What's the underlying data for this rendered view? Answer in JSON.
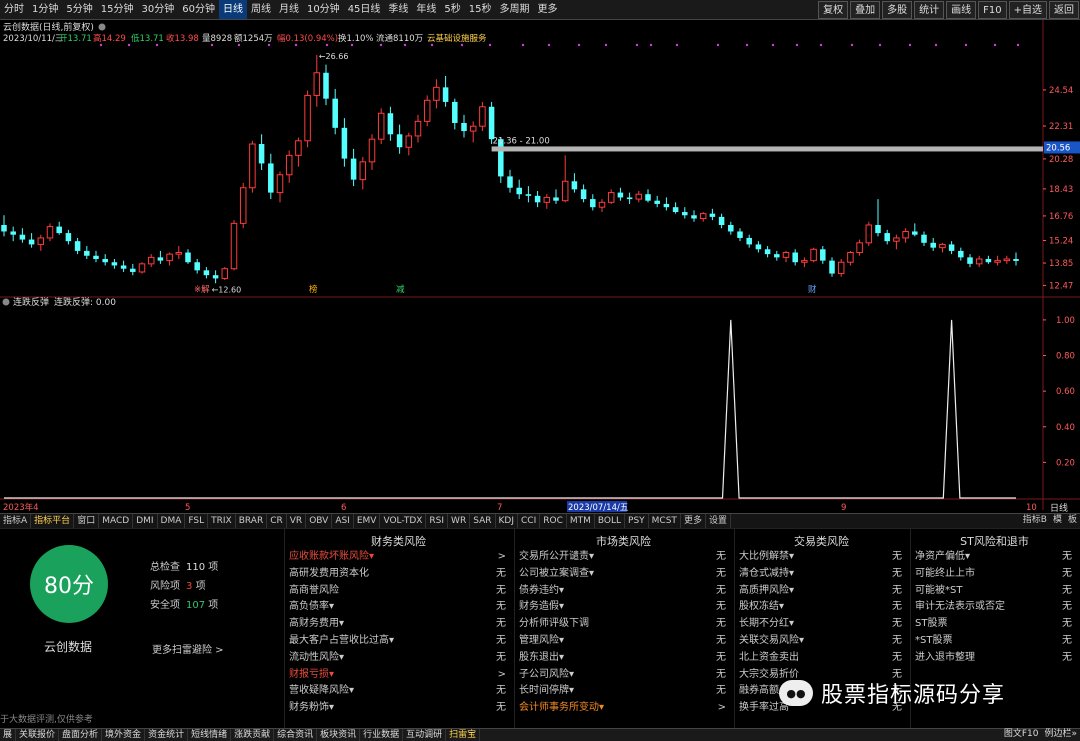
{
  "toolbar": {
    "periods": [
      "分时",
      "1分钟",
      "5分钟",
      "15分钟",
      "30分钟",
      "60分钟",
      "日线",
      "周线",
      "月线",
      "10分钟",
      "45日线",
      "季线",
      "年线",
      "5秒",
      "15秒",
      "多周期",
      "更多"
    ],
    "active_period": "日线",
    "right_buttons": [
      "复权",
      "叠加",
      "多股",
      "统计",
      "画线",
      "F10",
      "+自选",
      "返回"
    ]
  },
  "chart_header": {
    "title": "云创数据(日线,前复权)",
    "info_date": "2023/10/11/三",
    "info_open": "开13.71",
    "info_high": "高14.29",
    "info_low": "低13.71",
    "info_close": "收13.98",
    "info_volume": "量8928",
    "info_amount": "额1254万",
    "info_change": "幅0.13(0.94%)",
    "info_turnover": "换1.10%",
    "info_float": "流通8110万",
    "info_concept": "云基础设施服务"
  },
  "price_axis": {
    "labels": [
      "24.54",
      "22.31",
      "20.28",
      "18.43",
      "16.76",
      "15.24",
      "13.85",
      "12.47"
    ],
    "current_price": "20.56"
  },
  "annotations": {
    "high_mark": "26.66",
    "low_mark": "12.60",
    "range_label": "21.36 - 21.00",
    "event_markers": [
      "※解",
      "榜",
      "减",
      "财"
    ]
  },
  "lower_panel": {
    "title": "连跌反弹",
    "label": "连跌反弹: 0.00",
    "axis_labels": [
      "1.00",
      "0.80",
      "0.60",
      "0.40",
      "0.20"
    ]
  },
  "time_axis": {
    "labels": [
      "2023年4",
      "5",
      "6",
      "7",
      "2023/07/14/五",
      "9",
      "10"
    ],
    "right_label": "日线"
  },
  "indicator_tabs": {
    "items": [
      "指标A",
      "指标平台",
      "窗口",
      "MACD",
      "DMI",
      "DMA",
      "FSL",
      "TRIX",
      "BRAR",
      "CR",
      "VR",
      "OBV",
      "ASI",
      "EMV",
      "VOL-TDX",
      "RSI",
      "WR",
      "SAR",
      "KDJ",
      "CCI",
      "ROC",
      "MTM",
      "BOLL",
      "PSY",
      "MCST",
      "更多",
      "设置"
    ],
    "active": "指标平台",
    "right_items": [
      "指标B",
      "模",
      "板"
    ]
  },
  "risk": {
    "score": "80分",
    "brand": "云创数据",
    "total_label": "总检查",
    "total_value": "110",
    "total_unit": "项",
    "risk_label": "风险项",
    "risk_value": "3",
    "risk_unit": "项",
    "safe_label": "安全项",
    "safe_value": "107",
    "safe_unit": "项",
    "more_scan": "更多扫雷避险 >",
    "disclaimer": "于大数据评测,仅供参考",
    "columns": [
      {
        "title": "财务类风险",
        "rows": [
          {
            "label": "应收账款坏账风险▾",
            "value": ">",
            "style": "warn"
          },
          {
            "label": "高研发费用资本化",
            "value": "无",
            "style": ""
          },
          {
            "label": "高商誉风险",
            "value": "无",
            "style": ""
          },
          {
            "label": "高负债率▾",
            "value": "无",
            "style": ""
          },
          {
            "label": "高财务费用▾",
            "value": "无",
            "style": ""
          },
          {
            "label": "最大客户占营收比过高▾",
            "value": "无",
            "style": ""
          },
          {
            "label": "流动性风险▾",
            "value": "无",
            "style": ""
          },
          {
            "label": "财报亏损▾",
            "value": ">",
            "style": "warn"
          },
          {
            "label": "营收疑降风险▾",
            "value": "无",
            "style": ""
          },
          {
            "label": "财务粉饰▾",
            "value": "无",
            "style": ""
          }
        ]
      },
      {
        "title": "市场类风险",
        "rows": [
          {
            "label": "交易所公开谴责▾",
            "value": "无",
            "style": ""
          },
          {
            "label": "公司被立案调查▾",
            "value": "无",
            "style": ""
          },
          {
            "label": "债券违约▾",
            "value": "无",
            "style": ""
          },
          {
            "label": "财务造假▾",
            "value": "无",
            "style": ""
          },
          {
            "label": "分析师评级下调",
            "value": "无",
            "style": ""
          },
          {
            "label": "管理风险▾",
            "value": "无",
            "style": ""
          },
          {
            "label": "股东退出▾",
            "value": "无",
            "style": ""
          },
          {
            "label": "子公司风险▾",
            "value": "无",
            "style": ""
          },
          {
            "label": "长时间停牌▾",
            "value": "无",
            "style": ""
          },
          {
            "label": "会计师事务所变动▾",
            "value": ">",
            "style": "orange"
          }
        ]
      },
      {
        "title": "交易类风险",
        "rows": [
          {
            "label": "大比例解禁▾",
            "value": "无",
            "style": ""
          },
          {
            "label": "清仓式减持▾",
            "value": "无",
            "style": ""
          },
          {
            "label": "高质押风险▾",
            "value": "无",
            "style": ""
          },
          {
            "label": "股权冻结▾",
            "value": "无",
            "style": ""
          },
          {
            "label": "长期不分红▾",
            "value": "无",
            "style": ""
          },
          {
            "label": "关联交易风险▾",
            "value": "无",
            "style": ""
          },
          {
            "label": "北上资金卖出",
            "value": "无",
            "style": ""
          },
          {
            "label": "大宗交易折价",
            "value": "无",
            "style": ""
          },
          {
            "label": "融券高额",
            "value": "无",
            "style": ""
          },
          {
            "label": "换手率过高",
            "value": "无",
            "style": ""
          }
        ]
      },
      {
        "title": "ST风险和退市",
        "rows": [
          {
            "label": "净资产偏低▾",
            "value": "无",
            "style": ""
          },
          {
            "label": "可能终止上市",
            "value": "无",
            "style": ""
          },
          {
            "label": "可能被*ST",
            "value": "无",
            "style": ""
          },
          {
            "label": "审计无法表示或否定",
            "value": "无",
            "style": ""
          },
          {
            "label": "ST股票",
            "value": "无",
            "style": ""
          },
          {
            "label": "*ST股票",
            "value": "无",
            "style": ""
          },
          {
            "label": "进入退市整理",
            "value": "无",
            "style": ""
          }
        ]
      }
    ]
  },
  "bottom_bar": {
    "items": [
      "展",
      "关联报价",
      "盘面分析",
      "境外资金",
      "资金统计",
      "短线情绪",
      "涨跌贡献",
      "综合资讯",
      "板块资讯",
      "行业数据",
      "互动调研",
      "扫雷宝"
    ],
    "active": "扫雷宝",
    "right_items": [
      "图文F10",
      "例边栏»"
    ]
  },
  "watermark": {
    "text": "股票指标源码分享"
  },
  "colors": {
    "up": "#ff3b3b",
    "down": "#54ffff",
    "score_green": "#1aa15c",
    "background": "#000000"
  },
  "chart_data": [
    {
      "type": "candlestick",
      "title": "云创数据(日线,前复权)",
      "ylim": [
        12.0,
        27.5
      ],
      "y_ticks": [
        24.54,
        22.31,
        20.28,
        18.43,
        16.76,
        15.24,
        13.85,
        12.47
      ],
      "x_month_labels": [
        "2023年4",
        "5",
        "6",
        "7",
        "9",
        "10"
      ],
      "ohlc": [
        [
          16.2,
          16.8,
          15.5,
          15.8
        ],
        [
          15.8,
          16.1,
          15.2,
          15.6
        ],
        [
          15.6,
          16.0,
          15.1,
          15.3
        ],
        [
          15.3,
          15.7,
          14.8,
          15.0
        ],
        [
          15.0,
          15.6,
          14.6,
          15.4
        ],
        [
          15.4,
          16.3,
          15.2,
          16.1
        ],
        [
          16.1,
          16.4,
          15.6,
          15.7
        ],
        [
          15.7,
          15.9,
          15.0,
          15.2
        ],
        [
          15.2,
          15.4,
          14.4,
          14.6
        ],
        [
          14.6,
          14.9,
          14.1,
          14.3
        ],
        [
          14.3,
          14.6,
          13.9,
          14.1
        ],
        [
          14.1,
          14.4,
          13.7,
          13.9
        ],
        [
          13.9,
          14.1,
          13.5,
          13.7
        ],
        [
          13.7,
          14.0,
          13.3,
          13.5
        ],
        [
          13.5,
          13.8,
          13.1,
          13.3
        ],
        [
          13.3,
          13.9,
          13.2,
          13.8
        ],
        [
          13.8,
          14.4,
          13.6,
          14.2
        ],
        [
          14.2,
          14.6,
          13.8,
          14.0
        ],
        [
          14.0,
          14.5,
          13.7,
          14.4
        ],
        [
          14.4,
          14.9,
          14.1,
          14.5
        ],
        [
          14.5,
          14.7,
          13.8,
          13.9
        ],
        [
          13.9,
          14.1,
          13.2,
          13.4
        ],
        [
          13.4,
          13.6,
          12.9,
          13.1
        ],
        [
          13.1,
          13.4,
          12.6,
          12.9
        ],
        [
          12.9,
          13.6,
          12.8,
          13.5
        ],
        [
          13.5,
          16.5,
          13.4,
          16.3
        ],
        [
          16.3,
          18.8,
          16.0,
          18.5
        ],
        [
          18.5,
          21.4,
          18.2,
          21.2
        ],
        [
          21.2,
          21.8,
          19.6,
          20.0
        ],
        [
          20.0,
          20.6,
          17.8,
          18.2
        ],
        [
          18.2,
          19.5,
          17.6,
          19.3
        ],
        [
          19.3,
          20.8,
          18.8,
          20.5
        ],
        [
          20.5,
          21.6,
          19.8,
          21.4
        ],
        [
          21.4,
          24.5,
          21.0,
          24.2
        ],
        [
          24.2,
          26.7,
          23.5,
          25.6
        ],
        [
          25.6,
          26.1,
          23.6,
          24.0
        ],
        [
          24.0,
          24.6,
          21.8,
          22.2
        ],
        [
          22.2,
          22.8,
          19.8,
          20.3
        ],
        [
          20.3,
          20.9,
          18.6,
          19.0
        ],
        [
          19.0,
          20.4,
          18.4,
          20.1
        ],
        [
          20.1,
          21.8,
          19.6,
          21.5
        ],
        [
          21.5,
          23.4,
          21.2,
          23.1
        ],
        [
          23.1,
          23.5,
          21.4,
          21.8
        ],
        [
          21.8,
          22.4,
          20.6,
          21.0
        ],
        [
          21.0,
          21.9,
          20.5,
          21.7
        ],
        [
          21.7,
          23.0,
          21.3,
          22.6
        ],
        [
          22.6,
          24.2,
          22.3,
          23.9
        ],
        [
          23.9,
          25.2,
          23.4,
          24.7
        ],
        [
          24.7,
          25.4,
          23.5,
          23.8
        ],
        [
          23.8,
          24.0,
          22.1,
          22.5
        ],
        [
          22.5,
          23.0,
          21.6,
          22.0
        ],
        [
          22.0,
          22.6,
          21.3,
          22.3
        ],
        [
          22.3,
          23.8,
          22.0,
          23.5
        ],
        [
          23.5,
          23.8,
          21.2,
          21.5
        ],
        [
          21.5,
          21.6,
          18.8,
          19.2
        ],
        [
          19.2,
          19.6,
          18.2,
          18.5
        ],
        [
          18.5,
          19.0,
          17.8,
          18.1
        ],
        [
          18.1,
          18.6,
          17.6,
          18.0
        ],
        [
          18.0,
          18.3,
          17.3,
          17.6
        ],
        [
          17.6,
          18.1,
          17.2,
          17.9
        ],
        [
          17.9,
          18.4,
          17.5,
          17.7
        ],
        [
          17.7,
          20.5,
          17.6,
          18.9
        ],
        [
          18.9,
          19.4,
          18.2,
          18.4
        ],
        [
          18.4,
          18.7,
          17.6,
          17.8
        ],
        [
          17.8,
          18.1,
          17.1,
          17.3
        ],
        [
          17.3,
          17.8,
          17.0,
          17.6
        ],
        [
          17.6,
          18.4,
          17.5,
          18.2
        ],
        [
          18.2,
          18.5,
          17.7,
          17.9
        ],
        [
          17.9,
          18.2,
          17.5,
          17.8
        ],
        [
          17.8,
          18.3,
          17.6,
          18.1
        ],
        [
          18.1,
          18.4,
          17.6,
          17.7
        ],
        [
          17.7,
          18.0,
          17.3,
          17.5
        ],
        [
          17.5,
          17.9,
          17.1,
          17.3
        ],
        [
          17.3,
          17.6,
          16.9,
          17.0
        ],
        [
          17.0,
          17.3,
          16.6,
          16.8
        ],
        [
          16.8,
          17.1,
          16.4,
          16.6
        ],
        [
          16.6,
          17.0,
          16.4,
          16.9
        ],
        [
          16.9,
          17.2,
          16.5,
          16.7
        ],
        [
          16.7,
          16.9,
          16.0,
          16.2
        ],
        [
          16.2,
          16.4,
          15.6,
          15.8
        ],
        [
          15.8,
          16.0,
          15.2,
          15.4
        ],
        [
          15.4,
          15.6,
          14.8,
          15.0
        ],
        [
          15.0,
          15.2,
          14.5,
          14.7
        ],
        [
          14.7,
          14.9,
          14.2,
          14.4
        ],
        [
          14.4,
          14.6,
          14.0,
          14.2
        ],
        [
          14.2,
          14.6,
          13.9,
          14.5
        ],
        [
          14.5,
          14.7,
          13.7,
          13.9
        ],
        [
          13.9,
          14.2,
          13.6,
          14.0
        ],
        [
          14.0,
          14.8,
          13.9,
          14.7
        ],
        [
          14.7,
          14.9,
          13.8,
          14.0
        ],
        [
          14.0,
          14.2,
          13.0,
          13.2
        ],
        [
          13.2,
          14.1,
          13.0,
          13.9
        ],
        [
          13.9,
          14.6,
          13.7,
          14.5
        ],
        [
          14.5,
          15.3,
          14.3,
          15.1
        ],
        [
          15.1,
          16.4,
          14.9,
          16.2
        ],
        [
          16.2,
          17.8,
          15.5,
          15.7
        ],
        [
          15.7,
          15.9,
          15.0,
          15.2
        ],
        [
          15.2,
          15.6,
          14.7,
          15.4
        ],
        [
          15.4,
          16.0,
          15.1,
          15.8
        ],
        [
          15.8,
          16.3,
          15.5,
          15.6
        ],
        [
          15.6,
          15.8,
          14.9,
          15.1
        ],
        [
          15.1,
          15.4,
          14.6,
          14.8
        ],
        [
          14.8,
          15.1,
          14.5,
          15.0
        ],
        [
          15.0,
          15.2,
          14.4,
          14.6
        ],
        [
          14.6,
          14.8,
          14.0,
          14.2
        ],
        [
          14.2,
          14.4,
          13.6,
          13.8
        ],
        [
          13.8,
          14.3,
          13.6,
          14.1
        ],
        [
          14.1,
          14.3,
          13.8,
          13.9
        ],
        [
          13.9,
          14.3,
          13.7,
          14.0
        ],
        [
          14.0,
          14.3,
          13.8,
          14.1
        ],
        [
          14.1,
          14.5,
          13.7,
          13.98
        ]
      ]
    },
    {
      "type": "line",
      "title": "连跌反弹",
      "ylim": [
        0,
        1.05
      ],
      "y_ticks": [
        1.0,
        0.8,
        0.6,
        0.4,
        0.2
      ],
      "series": [
        {
          "name": "连跌反弹",
          "spikes_at_index": [
            79,
            103
          ],
          "value": 1.0,
          "current": 0.0
        }
      ]
    }
  ]
}
